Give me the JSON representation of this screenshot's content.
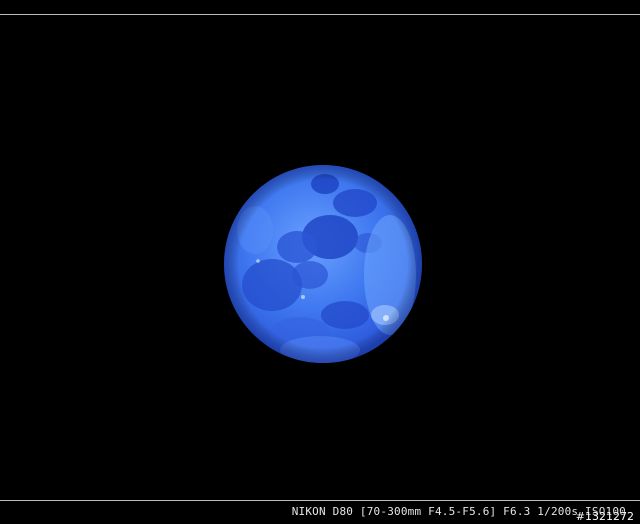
{
  "caption": {
    "exif_text": "NIKON D80 [70-300mm F4.5-F5.6] F6.3 1/200s ISO100",
    "photo_id": "#1321272"
  },
  "colors": {
    "background": "#000000",
    "moon_light": "#6fa6ff",
    "moon_mid": "#3b72ee",
    "moon_dark": "#1f48c8",
    "rule": "#bdbdbd"
  }
}
